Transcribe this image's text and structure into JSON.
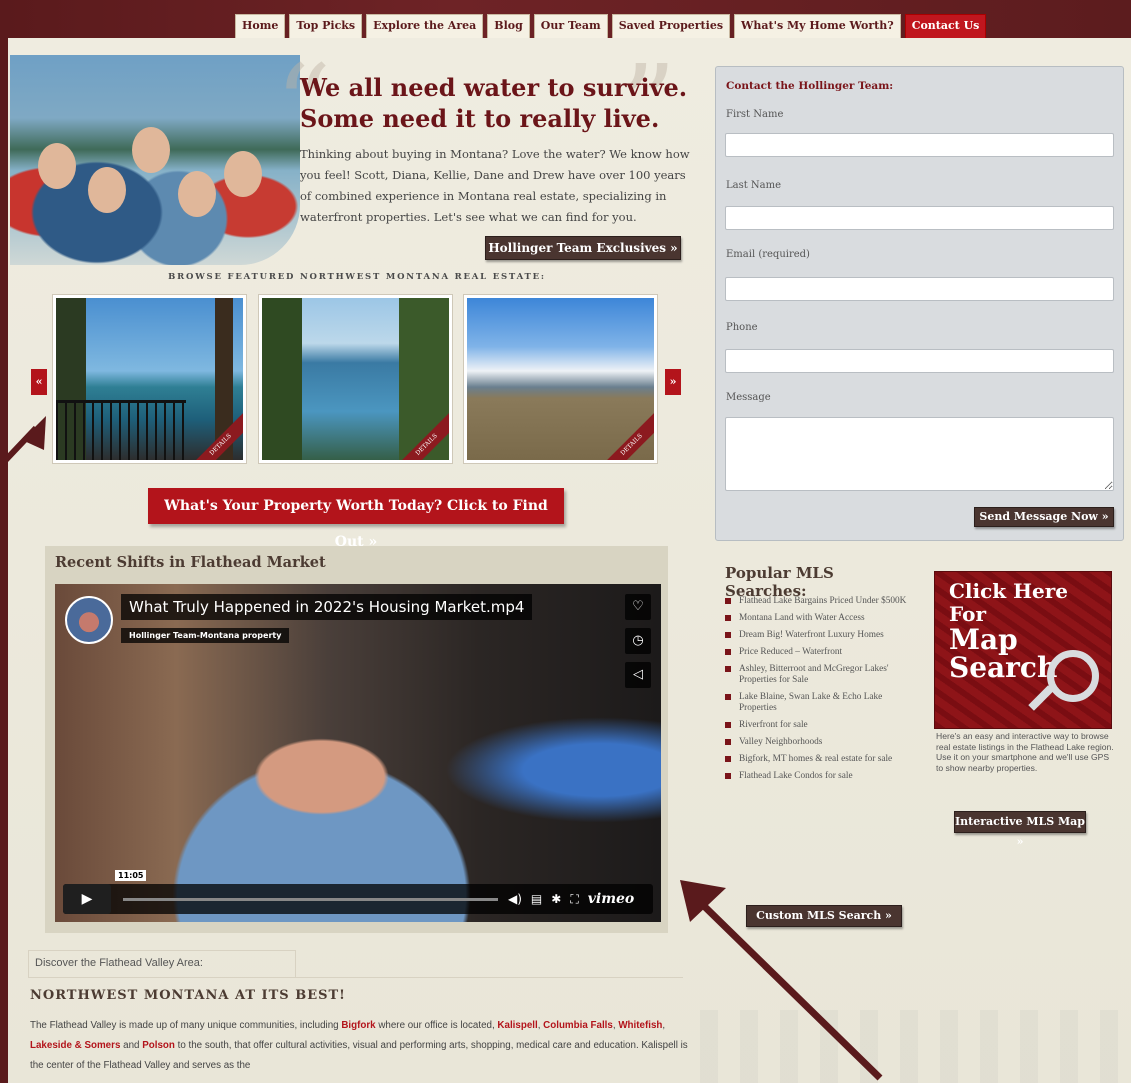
{
  "nav": {
    "items": [
      "Home",
      "Top Picks",
      "Explore the Area",
      "Blog",
      "Our Team",
      "Saved Properties",
      "What's My Home Worth?",
      "Contact Us"
    ]
  },
  "hero": {
    "title_line1": "We all need water to survive.",
    "title_line2": "Some need it to really live.",
    "text": "Thinking about buying in Montana? Love the water? We know how you feel! Scott, Diana, Kellie, Dane and Drew have over 100 years of combined experience in Montana real estate, specializing in waterfront properties. Let's see what we can find for you.",
    "exclusives_button": "Hollinger Team Exclusives »"
  },
  "featured": {
    "label": "BROWSE FEATURED NORTHWEST MONTANA REAL ESTATE:",
    "prev": "«",
    "next": "»",
    "ribbon": "DETAILS"
  },
  "worth_button": "What's Your Property Worth Today? Click to Find Out »",
  "video": {
    "heading": "Recent Shifts in Flathead Market",
    "title": "What Truly Happened in 2022's Housing Market.mp4",
    "channel": "Hollinger Team-Montana property",
    "time": "11:05",
    "logo": "vimeo"
  },
  "discover": {
    "tab": "Discover the Flathead Valley Area:",
    "heading": "NORTHWEST MONTANA AT ITS BEST!",
    "p1": "The Flathead Valley is made up of many unique communities, including ",
    "bigfork": "Bigfork",
    "p2": " where our office is located, ",
    "kalispell": "Kalispell",
    "p3": ", ",
    "columbia": "Columbia Falls",
    "p4": ", ",
    "whitefish": "Whitefish",
    "p5": ", ",
    "lakeside": "Lakeside & Somers",
    "p6": " and ",
    "polson": "Polson",
    "p7": " to the south, that offer cultural activities, visual and performing arts, shopping, medical care and education. Kalispell is the center of the Flathead Valley and serves as the"
  },
  "contact": {
    "title": "Contact the Hollinger Team:",
    "first_name": "First Name",
    "last_name": "Last Name",
    "email": "Email (required)",
    "phone": "Phone",
    "message": "Message",
    "send": "Send Message Now »"
  },
  "mls": {
    "title": "Popular MLS Searches:",
    "items": [
      "Flathead Lake Bargains Priced Under $500K",
      "Montana Land with Water Access",
      "Dream Big! Waterfront Luxury Homes",
      "Price Reduced – Waterfront",
      "Ashley, Bitterroot and McGregor Lakes' Properties for Sale",
      "Lake Blaine, Swan Lake & Echo Lake Properties",
      "Riverfront for sale",
      "Valley Neighborhoods",
      "Bigfork, MT homes & real estate for sale",
      "Flathead Lake Condos for sale"
    ],
    "custom": "Custom MLS Search »"
  },
  "map": {
    "line1": "Click Here For",
    "line2": "Map",
    "line3": "Search",
    "desc": "Here's an easy and interactive way to browse real estate listings in the Flathead Lake region. Use it on your smartphone and we'll use GPS to show nearby properties.",
    "button": "Interactive MLS Map »"
  },
  "colors": {
    "brand": "#6b1519",
    "accent_red": "#b3141b",
    "button_dark": "#4a3530",
    "arrow": "#5a1a1c"
  },
  "icons": [
    "heart-icon",
    "clock-icon",
    "share-icon",
    "play-icon",
    "volume-icon",
    "captions-icon",
    "settings-icon",
    "fullscreen-icon",
    "magnifier-icon"
  ]
}
